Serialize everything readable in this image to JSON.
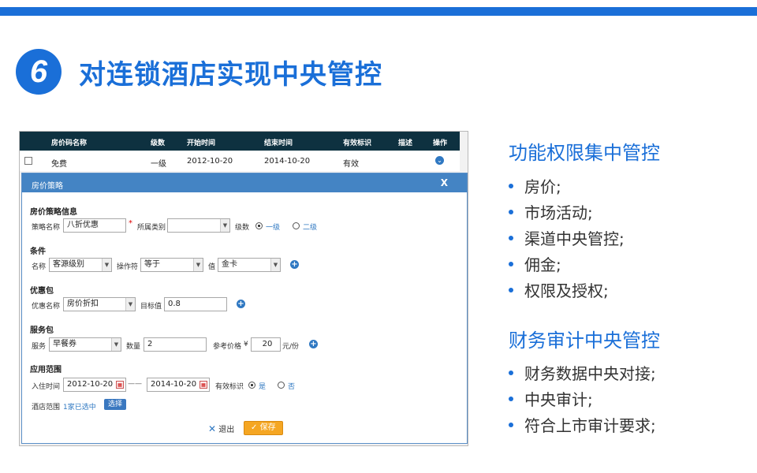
{
  "heading": {
    "number": "6",
    "title": "对连锁酒店实现中央管控"
  },
  "list": {
    "columns": [
      "房价码名称",
      "级数",
      "开始时间",
      "结束时间",
      "有效标识",
      "描述",
      "操作"
    ],
    "row": {
      "name": "免费",
      "level": "一级",
      "start": "2012-10-20",
      "end": "2014-10-20",
      "status": "有效"
    }
  },
  "dialog": {
    "title": "房价策略",
    "close": "X",
    "basic": {
      "section": "房价策略信息",
      "name_label": "策略名称",
      "name_value": "八折优惠",
      "required": "*",
      "category_label": "所属类别",
      "category_value": "",
      "level_label": "级数",
      "level_option1": "一级",
      "level_option2": "二级"
    },
    "condition": {
      "section": "条件",
      "name_label": "名称",
      "name_value": "客源级别",
      "op_label": "操作符",
      "op_value": "等于",
      "value_label": "值",
      "value_value": "金卡"
    },
    "package": {
      "section": "优惠包",
      "name_label": "优惠名称",
      "name_value": "房价折扣",
      "target_label": "目标值",
      "target_value": "0.8"
    },
    "service": {
      "section": "服务包",
      "service_label": "服务",
      "service_value": "早餐券",
      "qty_label": "数量",
      "qty_value": "2",
      "price_label": "参考价格",
      "currency": "¥",
      "price_value": "20",
      "unit": "元/份"
    },
    "scope": {
      "section": "应用范围",
      "checkin_label": "入住时间",
      "start_date": "2012-10-20",
      "dash": "——",
      "end_date": "2014-10-20",
      "valid_label": "有效标识",
      "yes": "是",
      "no": "否",
      "hotel_label": "酒店范围",
      "hotel_selected": "1家已选中",
      "pick_button": "选择"
    },
    "exit_icon": "✕",
    "exit_label": "退出",
    "save_icon": "✓",
    "save_label": "保存"
  },
  "right": {
    "group1_title": "功能权限集中管控",
    "group1_items": [
      "房价;",
      "市场活动;",
      "渠道中央管控;",
      "佣金;",
      "权限及授权;"
    ],
    "group2_title": "财务审计中央管控",
    "group2_items": [
      "财务数据中央对接;",
      "中央审计;",
      "符合上市审计要求;"
    ]
  },
  "colors": {
    "accent": "#1a6fd8",
    "header_dark": "#0e3140",
    "dialog_title": "#4484c4",
    "save": "#f5a623"
  }
}
